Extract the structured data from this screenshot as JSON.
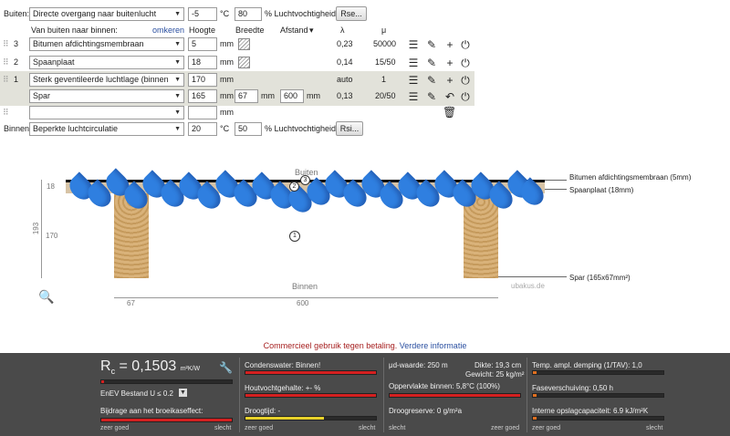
{
  "outside": {
    "label": "Buiten:",
    "condition": "Directe overgang naar buitenlucht",
    "temp": "-5",
    "temp_unit": "°C",
    "humidity": "80",
    "humidity_unit": "% Luchtvochtigheid",
    "button": "Rse..."
  },
  "header": {
    "direction": "Van buiten naar binnen:",
    "reverse": "omkeren",
    "height": "Hoogte",
    "width": "Breedte",
    "distance": "Afstand",
    "distance_arrow": "▾",
    "lambda": "λ",
    "mu": "μ"
  },
  "layers": [
    {
      "num": "3",
      "name": "Bitumen afdichtingsmembraan",
      "thickness": "5",
      "unit": "mm",
      "lambda": "0,23",
      "mu": "50000"
    },
    {
      "num": "2",
      "name": "Spaanplaat",
      "thickness": "18",
      "unit": "mm",
      "lambda": "0,14",
      "mu": "15/50"
    },
    {
      "num": "1",
      "name": "Sterk geventileerde luchtlage (binnen",
      "thickness": "170",
      "unit": "mm",
      "lambda": "auto",
      "mu": "1"
    },
    {
      "num": "",
      "name": "Spar",
      "thickness": "165",
      "unit": "mm",
      "width": "67",
      "width_unit": "mm",
      "distance": "600",
      "distance_unit": "mm",
      "lambda": "0,13",
      "mu": "20/50"
    },
    {
      "num": "",
      "name": "",
      "thickness": "",
      "unit": "mm",
      "lambda": "",
      "mu": ""
    }
  ],
  "inside": {
    "label": "Binnen:",
    "condition": "Beperkte luchtcirculatie",
    "temp": "20",
    "temp_unit": "°C",
    "humidity": "50",
    "humidity_unit": "% Luchtvochtigheid",
    "button": "Rsi..."
  },
  "drawing": {
    "outside_label": "Buiten",
    "inside_label": "Binnen",
    "dim_18": "18",
    "dim_193": "193",
    "dim_170": "170",
    "dim_67": "67",
    "dim_600": "600",
    "marker_1": "1",
    "marker_2": "2",
    "marker_3": "3",
    "callout_membrane": "Bitumen afdichtingsmembraan (5mm)",
    "callout_board": "Spaanplaat (18mm)",
    "callout_spar": "Spar (165x67mm²)",
    "watermark": "ubakus.de"
  },
  "notice": {
    "text": "Commercieel gebruik tegen betaling.",
    "link": "Verdere informatie"
  },
  "results": {
    "rc_symbol": "R",
    "rc_sub": "c",
    "rc_value": "= 0,1503",
    "rc_unit": "m²K/W",
    "rc_fill": 0.02,
    "standard": "EnEV Bestand U ≤ 0.2",
    "greenhouse": "Bijdrage aan het broeikaseffect:",
    "condensate": "Condenswater: Binnen!",
    "wood_moisture": "Houtvochtgehalte: +- %",
    "drying": "Droogtijd: -",
    "sd": "μd-waarde: 250 m",
    "thickness": "Dikte: 19,3 cm",
    "weight": "Gewicht: 25 kg/m²",
    "surface_temp": "Oppervlakte binnen: 5,8°C (100%)",
    "drying_reserve": "Droogreserve: 0 g/m²a",
    "temp_damping": "Temp. ampl. demping (1/TAV): 1,0",
    "phase_shift": "Faseverschuiving: 0,50 h",
    "heat_capacity": "Interne opslagcapaciteit: 6.9 kJ/m²K",
    "scale_good": "zeer goed",
    "scale_bad": "slecht",
    "colors": {
      "bad": "#d42020",
      "warn": "#e8d22a",
      "ok": "#e07020",
      "good": "#3aa030"
    }
  }
}
